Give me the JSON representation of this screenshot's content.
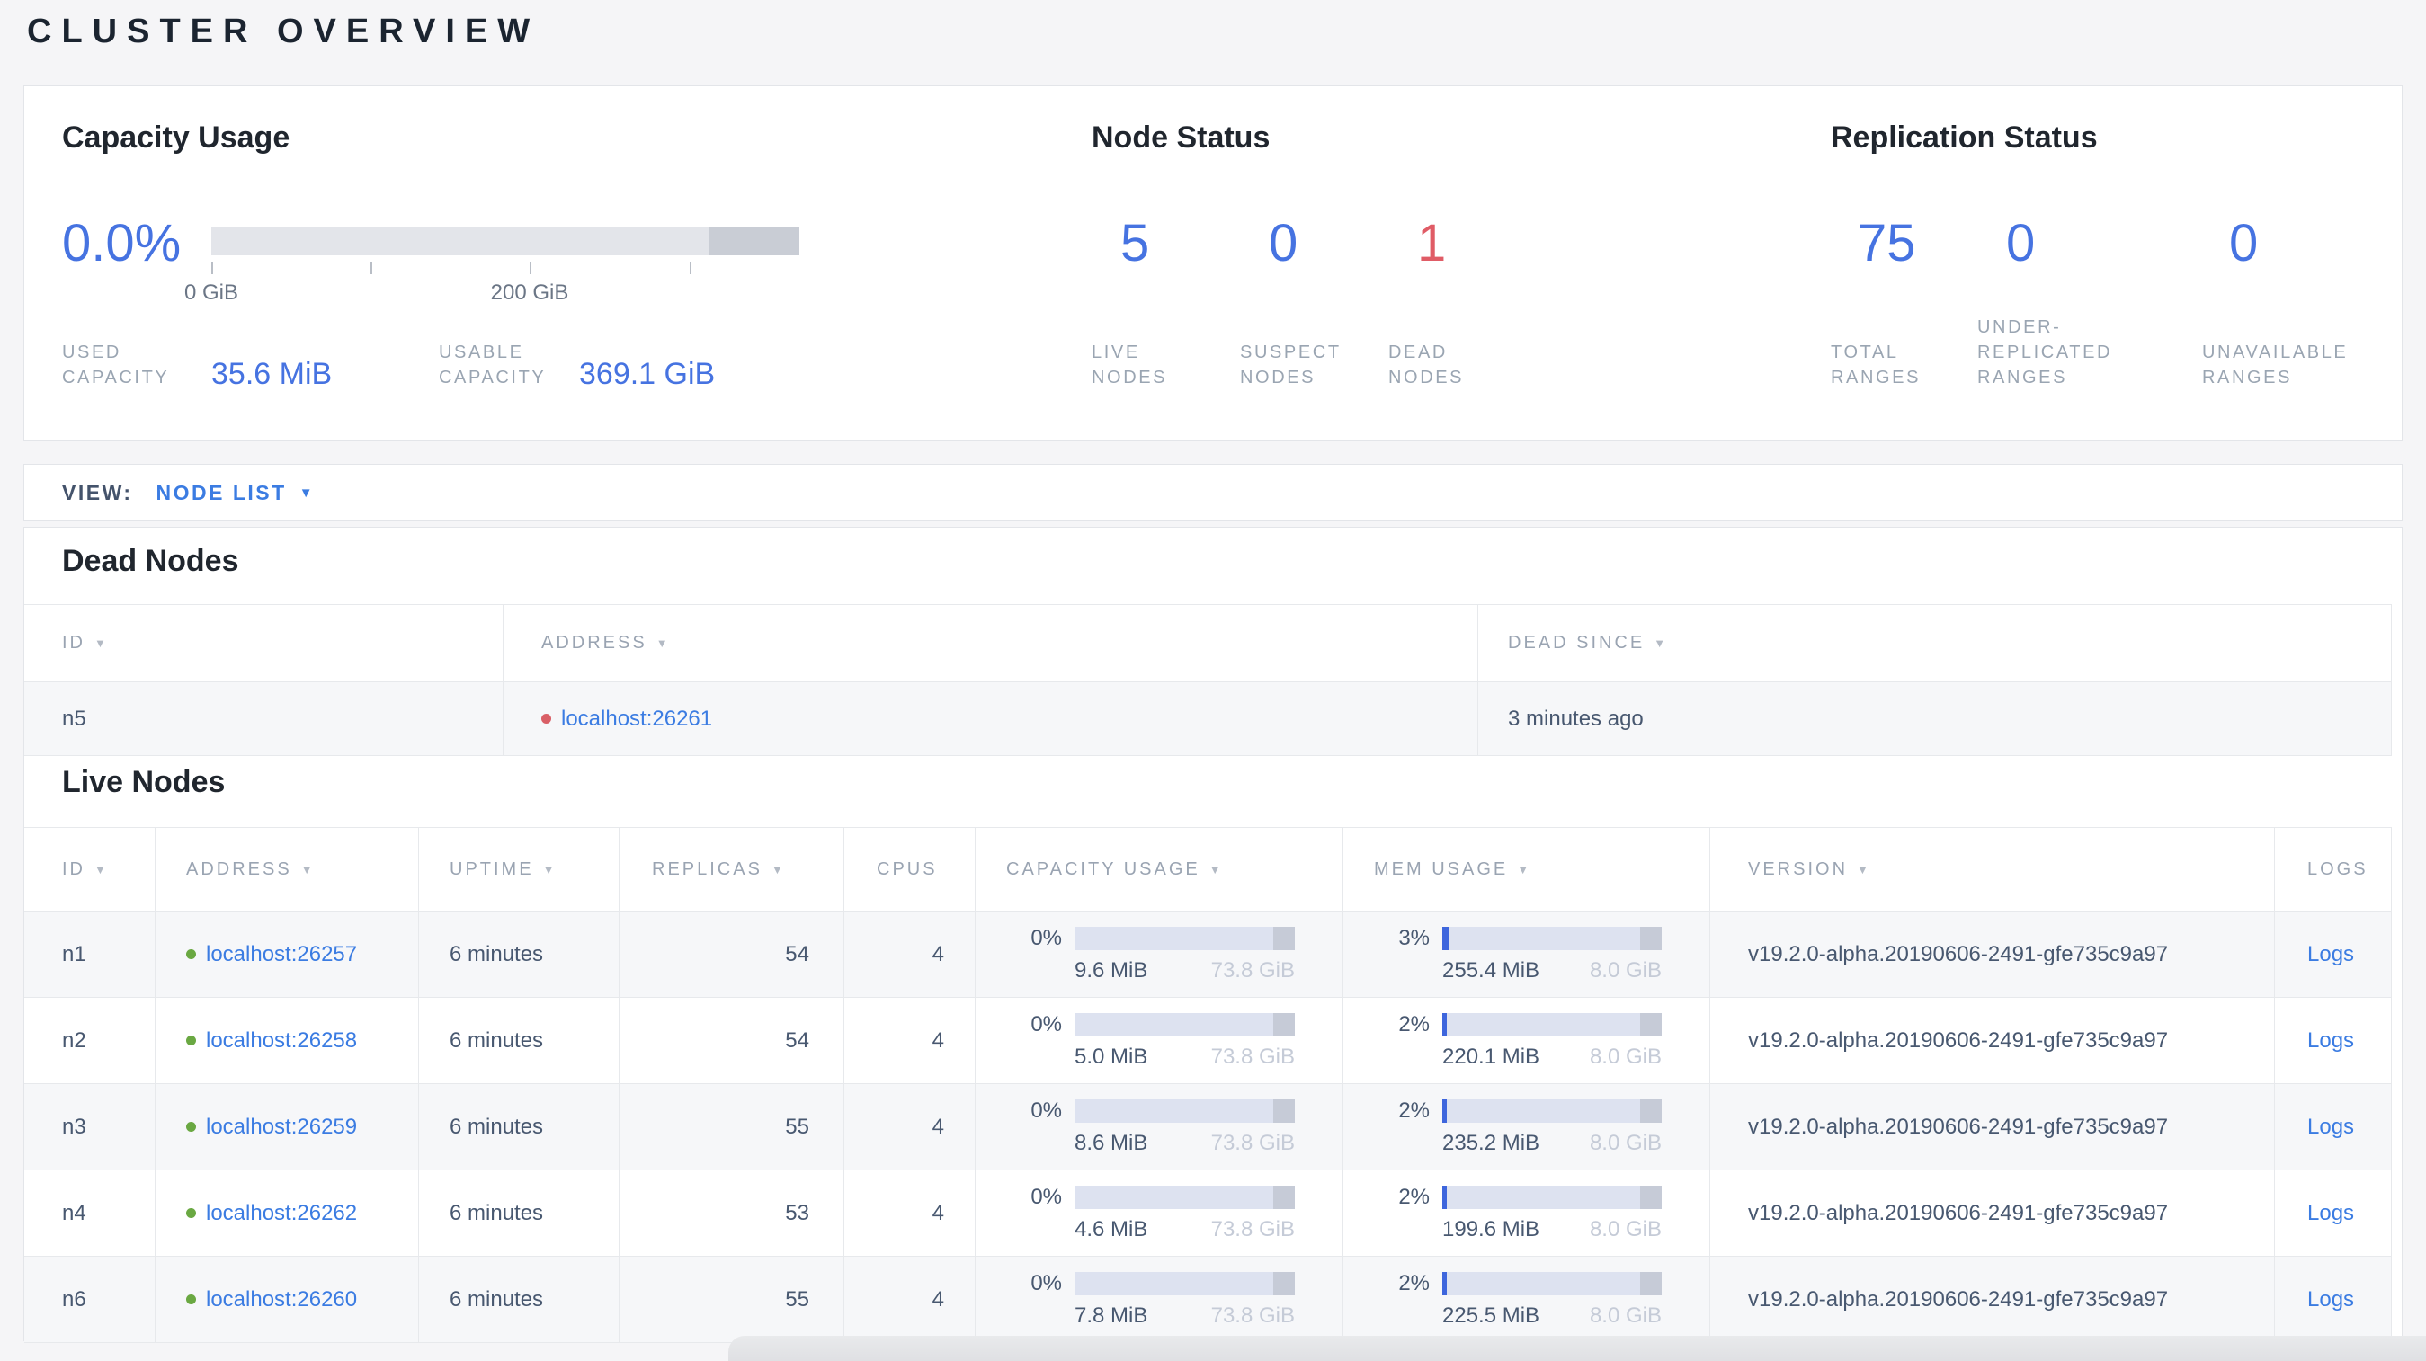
{
  "colors": {
    "accent_blue": "#4673e1",
    "link_blue": "#3b7ce2",
    "danger_red": "#e05c66",
    "live_dot_green": "#6aa842",
    "dead_dot_red": "#d95f66",
    "bar_track": "#dde2f0",
    "bar_fill_blue": "#3e66dd"
  },
  "icons": {
    "sort_desc": "▼",
    "caret_down": "▼"
  },
  "page": {
    "title": "CLUSTER OVERVIEW"
  },
  "summary": {
    "capacity": {
      "heading": "Capacity Usage",
      "percent": "0.0%",
      "axis_labels": [
        "0 GiB",
        "200 GiB"
      ],
      "used": {
        "label": "USED CAPACITY",
        "value": "35.6 MiB"
      },
      "usable": {
        "label": "USABLE CAPACITY",
        "value": "369.1 GiB"
      }
    },
    "node_status": {
      "heading": "Node Status",
      "live": {
        "value": "5",
        "label": "LIVE NODES"
      },
      "suspect": {
        "value": "0",
        "label": "SUSPECT NODES"
      },
      "dead": {
        "value": "1",
        "label": "DEAD NODES"
      }
    },
    "replication": {
      "heading": "Replication Status",
      "total": {
        "value": "75",
        "label": "TOTAL RANGES"
      },
      "under_replicated": {
        "value": "0",
        "label": "UNDER-REPLICATED RANGES"
      },
      "unavailable": {
        "value": "0",
        "label": "UNAVAILABLE RANGES"
      }
    }
  },
  "view_bar": {
    "label": "VIEW:",
    "selected": "NODE LIST"
  },
  "dead_nodes": {
    "heading": "Dead Nodes",
    "columns": [
      "ID",
      "ADDRESS",
      "DEAD SINCE"
    ],
    "rows": [
      {
        "id": "n5",
        "address": "localhost:26261",
        "dead_since": "3 minutes ago"
      }
    ]
  },
  "live_nodes": {
    "heading": "Live Nodes",
    "columns": [
      "ID",
      "ADDRESS",
      "UPTIME",
      "REPLICAS",
      "CPUS",
      "CAPACITY USAGE",
      "MEM USAGE",
      "VERSION",
      "LOGS"
    ],
    "rows": [
      {
        "id": "n1",
        "address": "localhost:26257",
        "uptime": "6 minutes",
        "replicas": "54",
        "cpus": "4",
        "capacity_pct": "0%",
        "capacity_used": "9.6 MiB",
        "capacity_total": "73.8 GiB",
        "mem_pct": "3%",
        "mem_used": "255.4 MiB",
        "mem_total": "8.0 GiB",
        "version": "v19.2.0-alpha.20190606-2491-gfe735c9a97",
        "logs_label": "Logs"
      },
      {
        "id": "n2",
        "address": "localhost:26258",
        "uptime": "6 minutes",
        "replicas": "54",
        "cpus": "4",
        "capacity_pct": "0%",
        "capacity_used": "5.0 MiB",
        "capacity_total": "73.8 GiB",
        "mem_pct": "2%",
        "mem_used": "220.1 MiB",
        "mem_total": "8.0 GiB",
        "version": "v19.2.0-alpha.20190606-2491-gfe735c9a97",
        "logs_label": "Logs"
      },
      {
        "id": "n3",
        "address": "localhost:26259",
        "uptime": "6 minutes",
        "replicas": "55",
        "cpus": "4",
        "capacity_pct": "0%",
        "capacity_used": "8.6 MiB",
        "capacity_total": "73.8 GiB",
        "mem_pct": "2%",
        "mem_used": "235.2 MiB",
        "mem_total": "8.0 GiB",
        "version": "v19.2.0-alpha.20190606-2491-gfe735c9a97",
        "logs_label": "Logs"
      },
      {
        "id": "n4",
        "address": "localhost:26262",
        "uptime": "6 minutes",
        "replicas": "53",
        "cpus": "4",
        "capacity_pct": "0%",
        "capacity_used": "4.6 MiB",
        "capacity_total": "73.8 GiB",
        "mem_pct": "2%",
        "mem_used": "199.6 MiB",
        "mem_total": "8.0 GiB",
        "version": "v19.2.0-alpha.20190606-2491-gfe735c9a97",
        "logs_label": "Logs"
      },
      {
        "id": "n6",
        "address": "localhost:26260",
        "uptime": "6 minutes",
        "replicas": "55",
        "cpus": "4",
        "capacity_pct": "0%",
        "capacity_used": "7.8 MiB",
        "capacity_total": "73.8 GiB",
        "mem_pct": "2%",
        "mem_used": "225.5 MiB",
        "mem_total": "8.0 GiB",
        "version": "v19.2.0-alpha.20190606-2491-gfe735c9a97",
        "logs_label": "Logs"
      }
    ]
  }
}
